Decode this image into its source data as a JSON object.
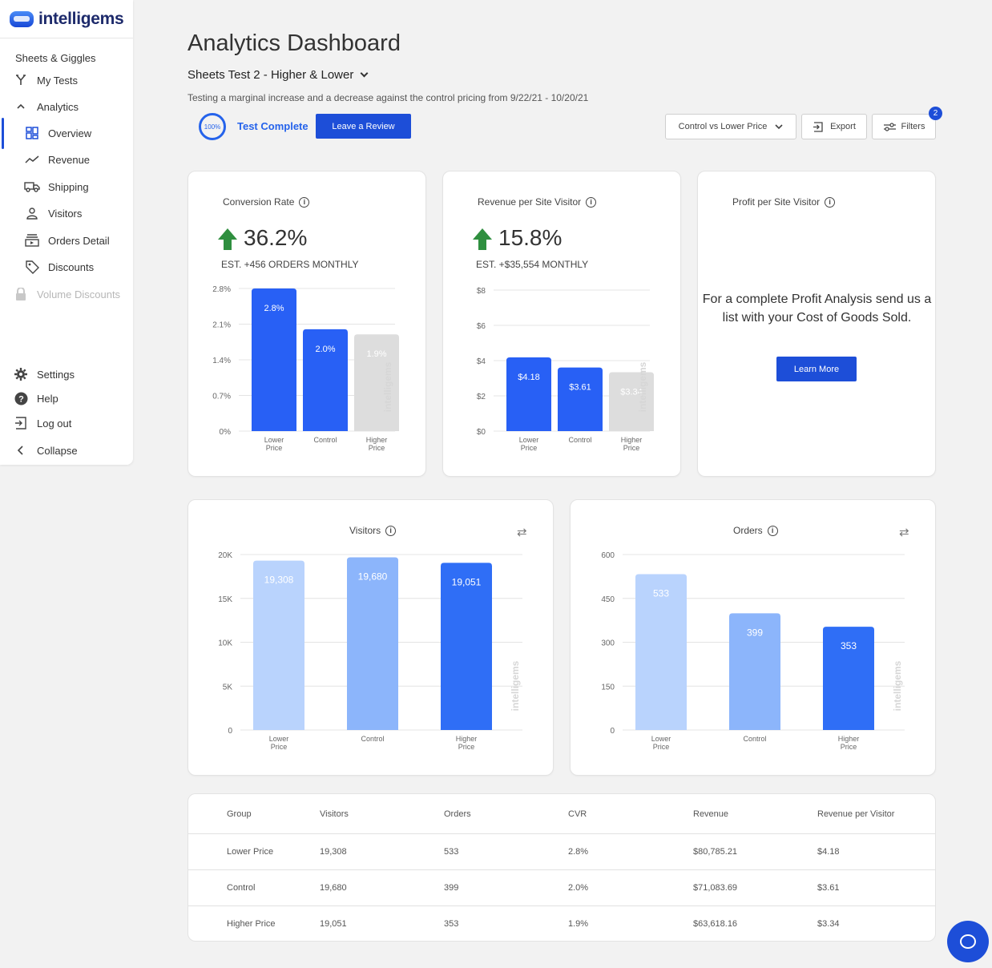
{
  "brand": {
    "name": "intelligems"
  },
  "sidebar": {
    "store": "Sheets & Giggles",
    "items": [
      {
        "label": "My Tests",
        "icon": "fork-icon"
      },
      {
        "label": "Analytics",
        "icon": "chevron-up-icon"
      },
      {
        "label": "Overview",
        "icon": "grid-icon"
      },
      {
        "label": "Revenue",
        "icon": "trend-icon"
      },
      {
        "label": "Shipping",
        "icon": "truck-icon"
      },
      {
        "label": "Visitors",
        "icon": "user-icon"
      },
      {
        "label": "Orders Detail",
        "icon": "orders-icon"
      },
      {
        "label": "Discounts",
        "icon": "tag-icon"
      },
      {
        "label": "Volume Discounts",
        "icon": "lock-icon"
      }
    ],
    "bottom": [
      {
        "label": "Settings",
        "icon": "gear-icon"
      },
      {
        "label": "Help",
        "icon": "help-icon"
      },
      {
        "label": "Log out",
        "icon": "logout-icon"
      },
      {
        "label": "Collapse",
        "icon": "chevron-left-icon"
      }
    ]
  },
  "header": {
    "title": "Analytics Dashboard",
    "test_name": "Sheets Test 2 - Higher & Lower",
    "description": "Testing a marginal increase and a decrease against the control pricing from 9/22/21 - 10/20/21",
    "progress": "100%",
    "status": "Test Complete",
    "review_button": "Leave a Review",
    "comparison_select": "Control vs Lower Price",
    "export_button": "Export",
    "filters_button": "Filters",
    "filters_count": "2"
  },
  "cards": {
    "conversion": {
      "title": "Conversion Rate",
      "value": "36.2%",
      "sub": "EST. +456 ORDERS MONTHLY"
    },
    "rpv": {
      "title": "Revenue per Site Visitor",
      "value": "15.8%",
      "sub": "EST. +$35,554 MONTHLY"
    },
    "profit": {
      "title": "Profit per Site Visitor",
      "message": "For a complete Profit Analysis send us a list with your Cost of Goods Sold.",
      "button": "Learn More"
    },
    "visitors": {
      "title": "Visitors"
    },
    "orders": {
      "title": "Orders"
    }
  },
  "watermark": "intelligems",
  "chart_data": [
    {
      "type": "bar",
      "categories": [
        "Lower Price",
        "Control",
        "Higher Price"
      ],
      "values": [
        2.8,
        2.0,
        1.9
      ],
      "labels": [
        "2.8%",
        "2.0%",
        "1.9%"
      ],
      "yticks": [
        "0%",
        "0.7%",
        "1.4%",
        "2.1%",
        "2.8%"
      ],
      "ylim": [
        0,
        2.8
      ],
      "colors": [
        "#2860f5",
        "#2860f5",
        "#dddddd"
      ]
    },
    {
      "type": "bar",
      "categories": [
        "Lower Price",
        "Control",
        "Higher Price"
      ],
      "values": [
        4.18,
        3.61,
        3.34
      ],
      "labels": [
        "$4.18",
        "$3.61",
        "$3.34"
      ],
      "yticks": [
        "$0",
        "$2",
        "$4",
        "$6",
        "$8"
      ],
      "ylim": [
        0,
        8
      ],
      "colors": [
        "#2860f5",
        "#2860f5",
        "#dddddd"
      ]
    },
    {
      "type": "bar",
      "categories": [
        "Lower Price",
        "Control",
        "Higher Price"
      ],
      "values": [
        19308,
        19680,
        19051
      ],
      "labels": [
        "19,308",
        "19,680",
        "19,051"
      ],
      "yticks": [
        "0",
        "5K",
        "10K",
        "15K",
        "20K"
      ],
      "ylim": [
        0,
        20000
      ],
      "colors": [
        "#b9d3fd",
        "#8cb5fb",
        "#2f6ef6"
      ]
    },
    {
      "type": "bar",
      "categories": [
        "Lower Price",
        "Control",
        "Higher Price"
      ],
      "values": [
        533,
        399,
        353
      ],
      "labels": [
        "533",
        "399",
        "353"
      ],
      "yticks": [
        "0",
        "150",
        "300",
        "450",
        "600"
      ],
      "ylim": [
        0,
        600
      ],
      "colors": [
        "#b9d3fd",
        "#8cb5fb",
        "#2f6ef6"
      ]
    }
  ],
  "table": {
    "headers": [
      "Group",
      "Visitors",
      "Orders",
      "CVR",
      "Revenue",
      "Revenue per Visitor"
    ],
    "rows": [
      [
        "Lower Price",
        "19,308",
        "533",
        "2.8%",
        "$80,785.21",
        "$4.18"
      ],
      [
        "Control",
        "19,680",
        "399",
        "2.0%",
        "$71,083.69",
        "$3.61"
      ],
      [
        "Higher Price",
        "19,051",
        "353",
        "1.9%",
        "$63,618.16",
        "$3.34"
      ]
    ]
  }
}
